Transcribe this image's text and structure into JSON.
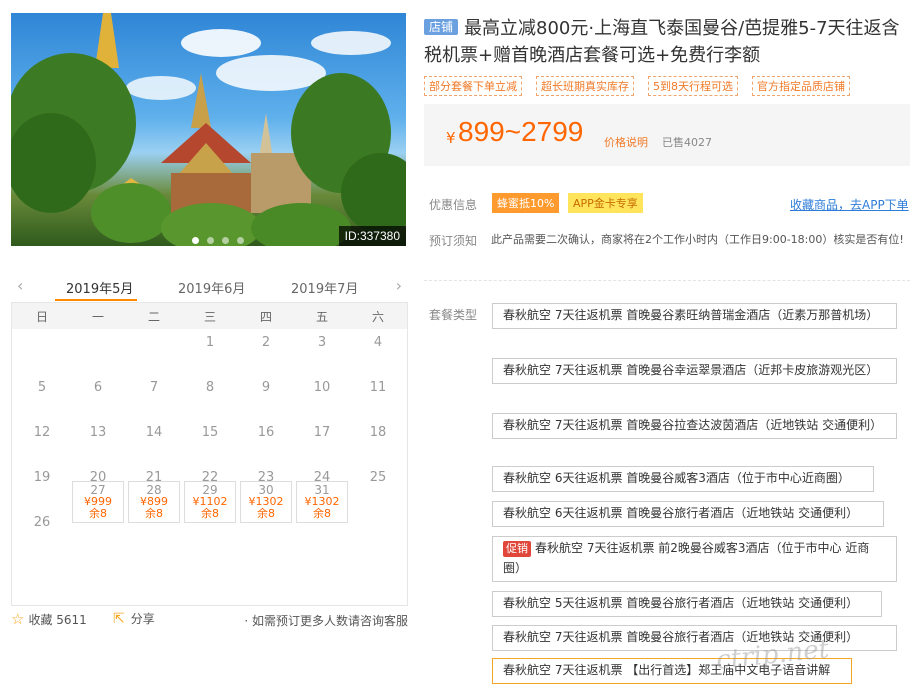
{
  "hero": {
    "image_id": "ID:337380",
    "dots": 4,
    "active_dot": 0
  },
  "calendar": {
    "months": [
      "2019年5月",
      "2019年6月",
      "2019年7月"
    ],
    "prev_arrow": "‹",
    "next_arrow": "›",
    "weekdays": [
      "日",
      "一",
      "二",
      "三",
      "四",
      "五",
      "六"
    ],
    "plain_days": [
      "1",
      "2",
      "3",
      "4",
      "5",
      "6",
      "7",
      "8",
      "9",
      "10",
      "11",
      "12",
      "13",
      "14",
      "15",
      "16",
      "17",
      "18",
      "19",
      "20",
      "21",
      "22",
      "23",
      "24",
      "25",
      "26"
    ],
    "available_days": [
      {
        "day": "27",
        "price": "¥999",
        "stock": "余8"
      },
      {
        "day": "28",
        "price": "¥899",
        "stock": "余8"
      },
      {
        "day": "29",
        "price": "¥1102",
        "stock": "余8"
      },
      {
        "day": "30",
        "price": "¥1302",
        "stock": "余8"
      },
      {
        "day": "31",
        "price": "¥1302",
        "stock": "余8"
      }
    ]
  },
  "footer": {
    "favorite_label": "收藏 5611",
    "share_label": "分享",
    "consult_text": "· 如需预订更多人数请咨询客服"
  },
  "product": {
    "shop_badge": "店铺",
    "title": "最高立减800元·上海直飞泰国曼谷/芭提雅5-7天往返含税机票+赠首晚酒店套餐可选+免费行李额",
    "tags": [
      "部分套餐下单立减",
      "超长班期真实库存",
      "5到8天行程可选",
      "官方指定品质店铺"
    ],
    "price_currency": "¥",
    "price_range": "899~2799",
    "price_note": "价格说明",
    "sold": "已售4027",
    "discount_label": "优惠信息",
    "discounts": [
      "蜂蜜抵10%",
      "APP金卡专享"
    ],
    "app_link": "收藏商品，去APP下单",
    "booking_label": "预订须知",
    "booking_notice": "此产品需要二次确认，商家将在2个工作小时内（工作日9:00-18:00）核实是否有位!",
    "package_label": "套餐类型",
    "packages": [
      {
        "badge": "",
        "text": "春秋航空 7天往返机票 首晚曼谷素旺纳普瑞金酒店（近素万那普机场）"
      },
      {
        "badge": "",
        "text": "春秋航空 7天往返机票 首晚曼谷幸运翠景酒店（近邦卡皮旅游观光区）"
      },
      {
        "badge": "",
        "text": "春秋航空 7天往返机票 首晚曼谷拉查达波茵酒店（近地铁站 交通便利）"
      },
      {
        "badge": "",
        "text": "春秋航空 6天往返机票 首晚曼谷威客3酒店（位于市中心近商圈）"
      },
      {
        "badge": "",
        "text": "春秋航空 6天往返机票 首晚曼谷旅行者酒店（近地铁站 交通便利）"
      },
      {
        "badge": "促销",
        "text": "春秋航空 7天往返机票 前2晚曼谷威客3酒店（位于市中心 近商圈）"
      },
      {
        "badge": "",
        "text": "春秋航空 5天往返机票 首晚曼谷旅行者酒店（近地铁站 交通便利）"
      },
      {
        "badge": "",
        "text": "春秋航空 7天往返机票 首晚曼谷旅行者酒店（近地铁站 交通便利）"
      },
      {
        "badge": "",
        "text": "春秋航空 7天往返机票 【出行首选】郑王庙中文电子语音讲解"
      }
    ]
  },
  "watermark": "ctrip.net",
  "colors": {
    "accent": "#ff6600",
    "shop_badge": "#6a9fe0",
    "promo_orange": "#ff9a2e",
    "promo_yellow": "#ffe45c",
    "link": "#2d7cd8",
    "sale_badge": "#e0463a"
  }
}
